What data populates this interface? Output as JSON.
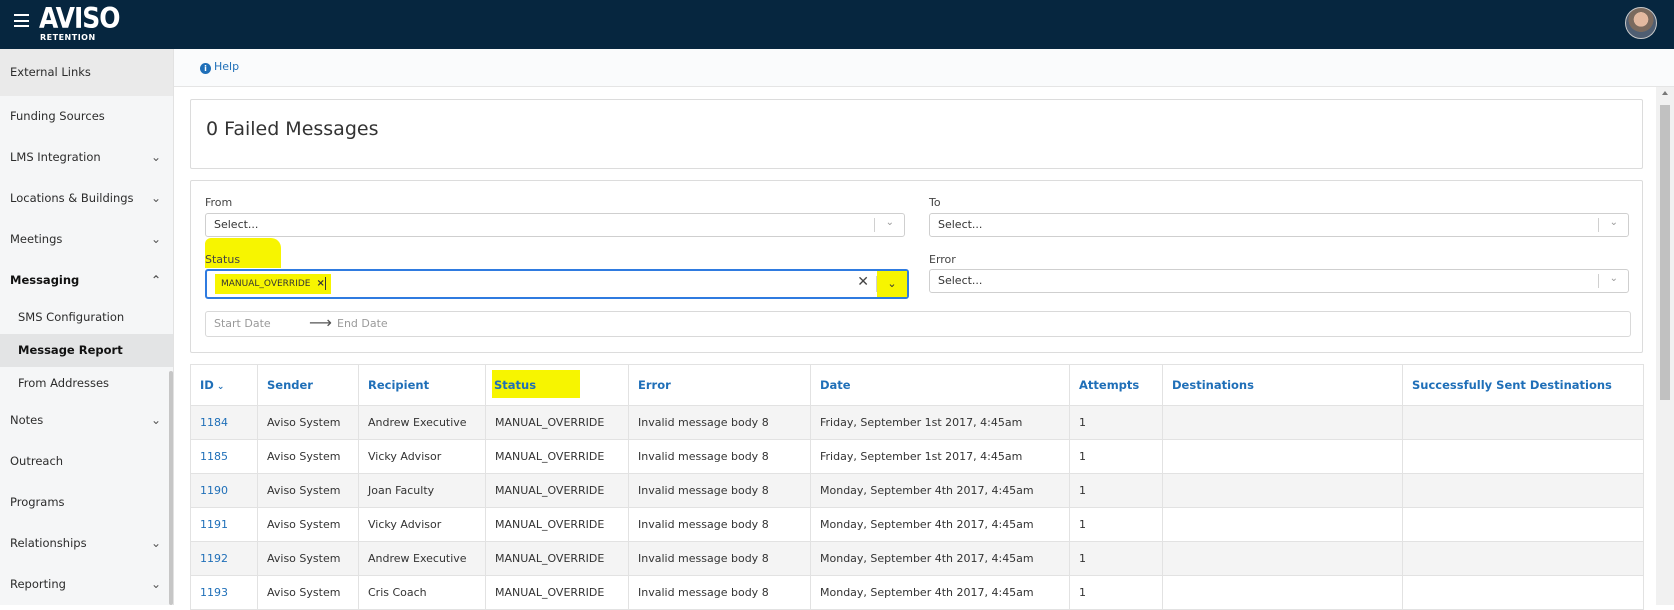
{
  "brand": {
    "name": "AVISO",
    "sub": "RETENTION"
  },
  "sidebar": {
    "items": [
      {
        "label": "External Links",
        "chevron": ""
      },
      {
        "label": "Funding Sources",
        "chevron": ""
      },
      {
        "label": "LMS Integration",
        "chevron": "⌄"
      },
      {
        "label": "Locations & Buildings",
        "chevron": "⌄"
      },
      {
        "label": "Meetings",
        "chevron": "⌄"
      },
      {
        "label": "Messaging",
        "chevron": "⌃"
      },
      {
        "label": "SMS Configuration"
      },
      {
        "label": "Message Report"
      },
      {
        "label": "From Addresses"
      },
      {
        "label": "Notes",
        "chevron": "⌄"
      },
      {
        "label": "Outreach",
        "chevron": ""
      },
      {
        "label": "Programs",
        "chevron": ""
      },
      {
        "label": "Relationships",
        "chevron": "⌄"
      },
      {
        "label": "Reporting",
        "chevron": "⌄"
      }
    ]
  },
  "help": {
    "label": "Help"
  },
  "summary": {
    "title": "0 Failed Messages"
  },
  "filters": {
    "from_label": "From",
    "from_placeholder": "Select...",
    "to_label": "To",
    "to_placeholder": "Select...",
    "status_label": "Status",
    "status_tag": "MANUAL_OVERRIDE",
    "error_label": "Error",
    "error_placeholder": "Select...",
    "start_date": "Start Date",
    "end_date": "End Date"
  },
  "table": {
    "headers": [
      "ID",
      "Sender",
      "Recipient",
      "Status",
      "Error",
      "Date",
      "Attempts",
      "Destinations",
      "Successfully Sent Destinations"
    ],
    "rows": [
      [
        "1184",
        "Aviso System",
        "Andrew Executive",
        "MANUAL_OVERRIDE",
        "Invalid message body 8",
        "Friday, September 1st 2017, 4:45am",
        "1",
        "",
        ""
      ],
      [
        "1185",
        "Aviso System",
        "Vicky Advisor",
        "MANUAL_OVERRIDE",
        "Invalid message body 8",
        "Friday, September 1st 2017, 4:45am",
        "1",
        "",
        ""
      ],
      [
        "1190",
        "Aviso System",
        "Joan Faculty",
        "MANUAL_OVERRIDE",
        "Invalid message body 8",
        "Monday, September 4th 2017, 4:45am",
        "1",
        "",
        ""
      ],
      [
        "1191",
        "Aviso System",
        "Vicky Advisor",
        "MANUAL_OVERRIDE",
        "Invalid message body 8",
        "Monday, September 4th 2017, 4:45am",
        "1",
        "",
        ""
      ],
      [
        "1192",
        "Aviso System",
        "Andrew Executive",
        "MANUAL_OVERRIDE",
        "Invalid message body 8",
        "Monday, September 4th 2017, 4:45am",
        "1",
        "",
        ""
      ],
      [
        "1193",
        "Aviso System",
        "Cris Coach",
        "MANUAL_OVERRIDE",
        "Invalid message body 8",
        "Monday, September 4th 2017, 4:45am",
        "1",
        "",
        ""
      ]
    ]
  },
  "colors": {
    "topbar": "#06263f",
    "link": "#1f6fb8",
    "highlight": "#f7f500",
    "focus": "#2f7be0"
  }
}
